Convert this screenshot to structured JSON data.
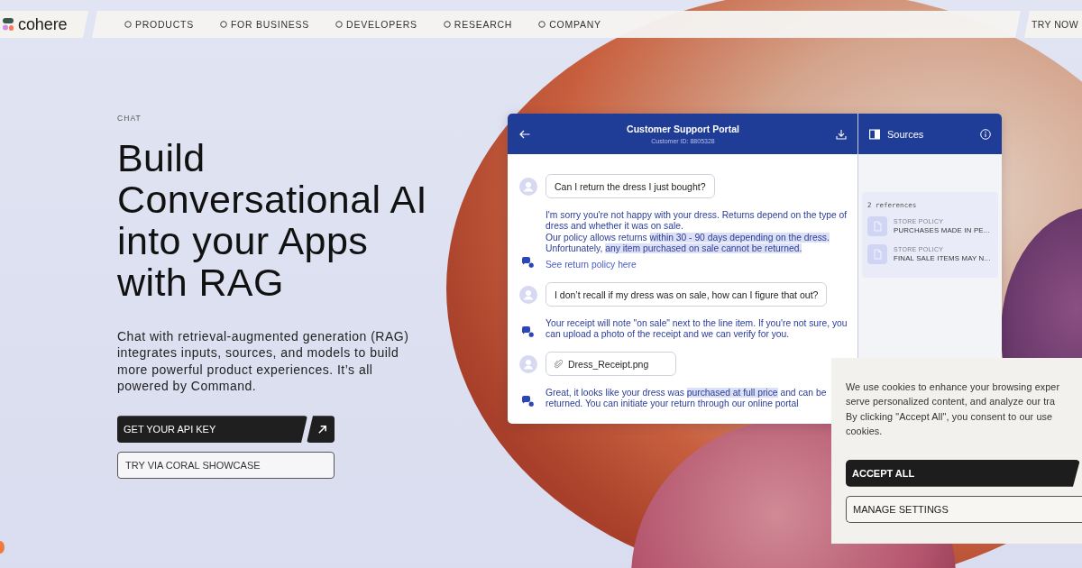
{
  "nav": {
    "logo": "cohere",
    "items": [
      {
        "label": "PRODUCTS"
      },
      {
        "label": "FOR BUSINESS"
      },
      {
        "label": "DEVELOPERS"
      },
      {
        "label": "RESEARCH"
      },
      {
        "label": "COMPANY"
      }
    ],
    "cta": "TRY NOW"
  },
  "hero": {
    "eyebrow": "CHAT",
    "heading_lines": [
      "Build",
      "Conversational AI",
      "into your Apps",
      "with RAG"
    ],
    "description": "Chat with retrieval-augmented generation (RAG) integrates inputs, sources, and models to build more powerful product experiences. It’s all powered by Command.",
    "primary_button": "GET YOUR API KEY",
    "secondary_button": "TRY VIA CORAL SHOWCASE"
  },
  "chat": {
    "title": "Customer Support Portal",
    "subtitle": "Customer ID: 8805328",
    "messages": [
      {
        "kind": "user",
        "text": "Can I return the dress I just bought?"
      },
      {
        "kind": "bot",
        "paragraphs": [
          [
            {
              "text": "I'm sorry you're not happy with your dress. Returns depend on the type of dress and whether it was on sale.",
              "highlighted": false
            }
          ],
          [
            {
              "text": "Our policy allows returns ",
              "highlighted": false
            },
            {
              "text": "within 30 - 90 days depending on the dress.",
              "highlighted": true
            }
          ],
          [
            {
              "text": "Unfortunately, ",
              "highlighted": false
            },
            {
              "text": "any item purchased on sale cannot be returned.",
              "highlighted": true
            }
          ]
        ],
        "link": "See return policy here"
      },
      {
        "kind": "user",
        "text": "I don’t recall if my dress was on sale, how can I figure that out?"
      },
      {
        "kind": "bot",
        "paragraphs": [
          [
            {
              "text": "Your receipt will note \"on sale\" next to the line item. If you're not sure, you can upload a photo of the receipt and we can verify for you.",
              "highlighted": false
            }
          ]
        ]
      },
      {
        "kind": "attachment",
        "text": "Dress_Receipt.png"
      },
      {
        "kind": "bot",
        "paragraphs": [
          [
            {
              "text": "Great, it looks like your dress was ",
              "highlighted": false
            },
            {
              "text": "purchased at full price",
              "highlighted": true
            },
            {
              "text": " and can be returned. You can initiate your return through our online portal",
              "highlighted": false
            }
          ]
        ]
      }
    ]
  },
  "sources": {
    "title": "Sources",
    "count": "2 references",
    "references": [
      {
        "category": "STORE POLICY",
        "title": "PURCHASES MADE IN PE..."
      },
      {
        "category": "STORE POLICY",
        "title": "FINAL SALE ITEMS MAY N..."
      }
    ]
  },
  "cookie_banner": {
    "lines": [
      "We use cookies to enhance your browsing exper",
      "serve personalized content, and analyze our tra",
      "By clicking \"Accept All\", you consent to our use",
      "cookies."
    ],
    "accept_button": "ACCEPT ALL",
    "manage_button": "MANAGE SETTINGS"
  }
}
